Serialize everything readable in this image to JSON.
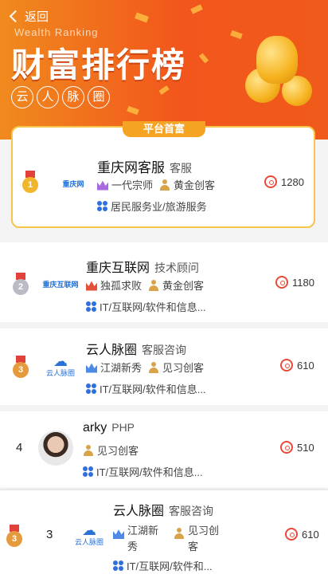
{
  "header": {
    "back_label": "返回",
    "en_title": "Wealth Ranking",
    "title": "财富排行榜",
    "sub_chars": [
      "云",
      "人",
      "脉",
      "圈"
    ]
  },
  "top_label": "平台首富",
  "entries": [
    {
      "rank": "1",
      "name": "重庆网客服",
      "role": "客服",
      "level": "一代宗师",
      "badge": "黄金创客",
      "industry": "居民服务业/旅游服务",
      "score": "1280",
      "logo": "重庆网"
    },
    {
      "rank": "2",
      "name": "重庆互联网",
      "role": "技术顾问",
      "level": "独孤求败",
      "badge": "黄金创客",
      "industry": "IT/互联网/软件和信息...",
      "score": "1180",
      "logo": "重庆互联网"
    },
    {
      "rank": "3",
      "name": "云人脉圈",
      "role": "客服咨询",
      "level": "江湖新秀",
      "badge": "见习创客",
      "industry": "IT/互联网/软件和信息...",
      "score": "610",
      "logo": "云人脉圈"
    },
    {
      "rank": "4",
      "name": "arky",
      "role": "PHP",
      "badge": "见习创客",
      "industry": "IT/互联网/软件和信息...",
      "score": "510"
    },
    {
      "rank": "3",
      "name": "云人脉圈",
      "role": "客服咨询",
      "level_line1": "江湖新",
      "level_line2": "秀",
      "badge_line1": "见习创",
      "badge_line2": "客",
      "industry": "IT/互联网/软件和...",
      "score": "610",
      "logo": "云人脉圈"
    }
  ],
  "colors": {
    "accent": "#f2561c",
    "gold": "#f7c44a",
    "icon_blue": "#2f6fe0",
    "score_red": "#e84a3a"
  }
}
